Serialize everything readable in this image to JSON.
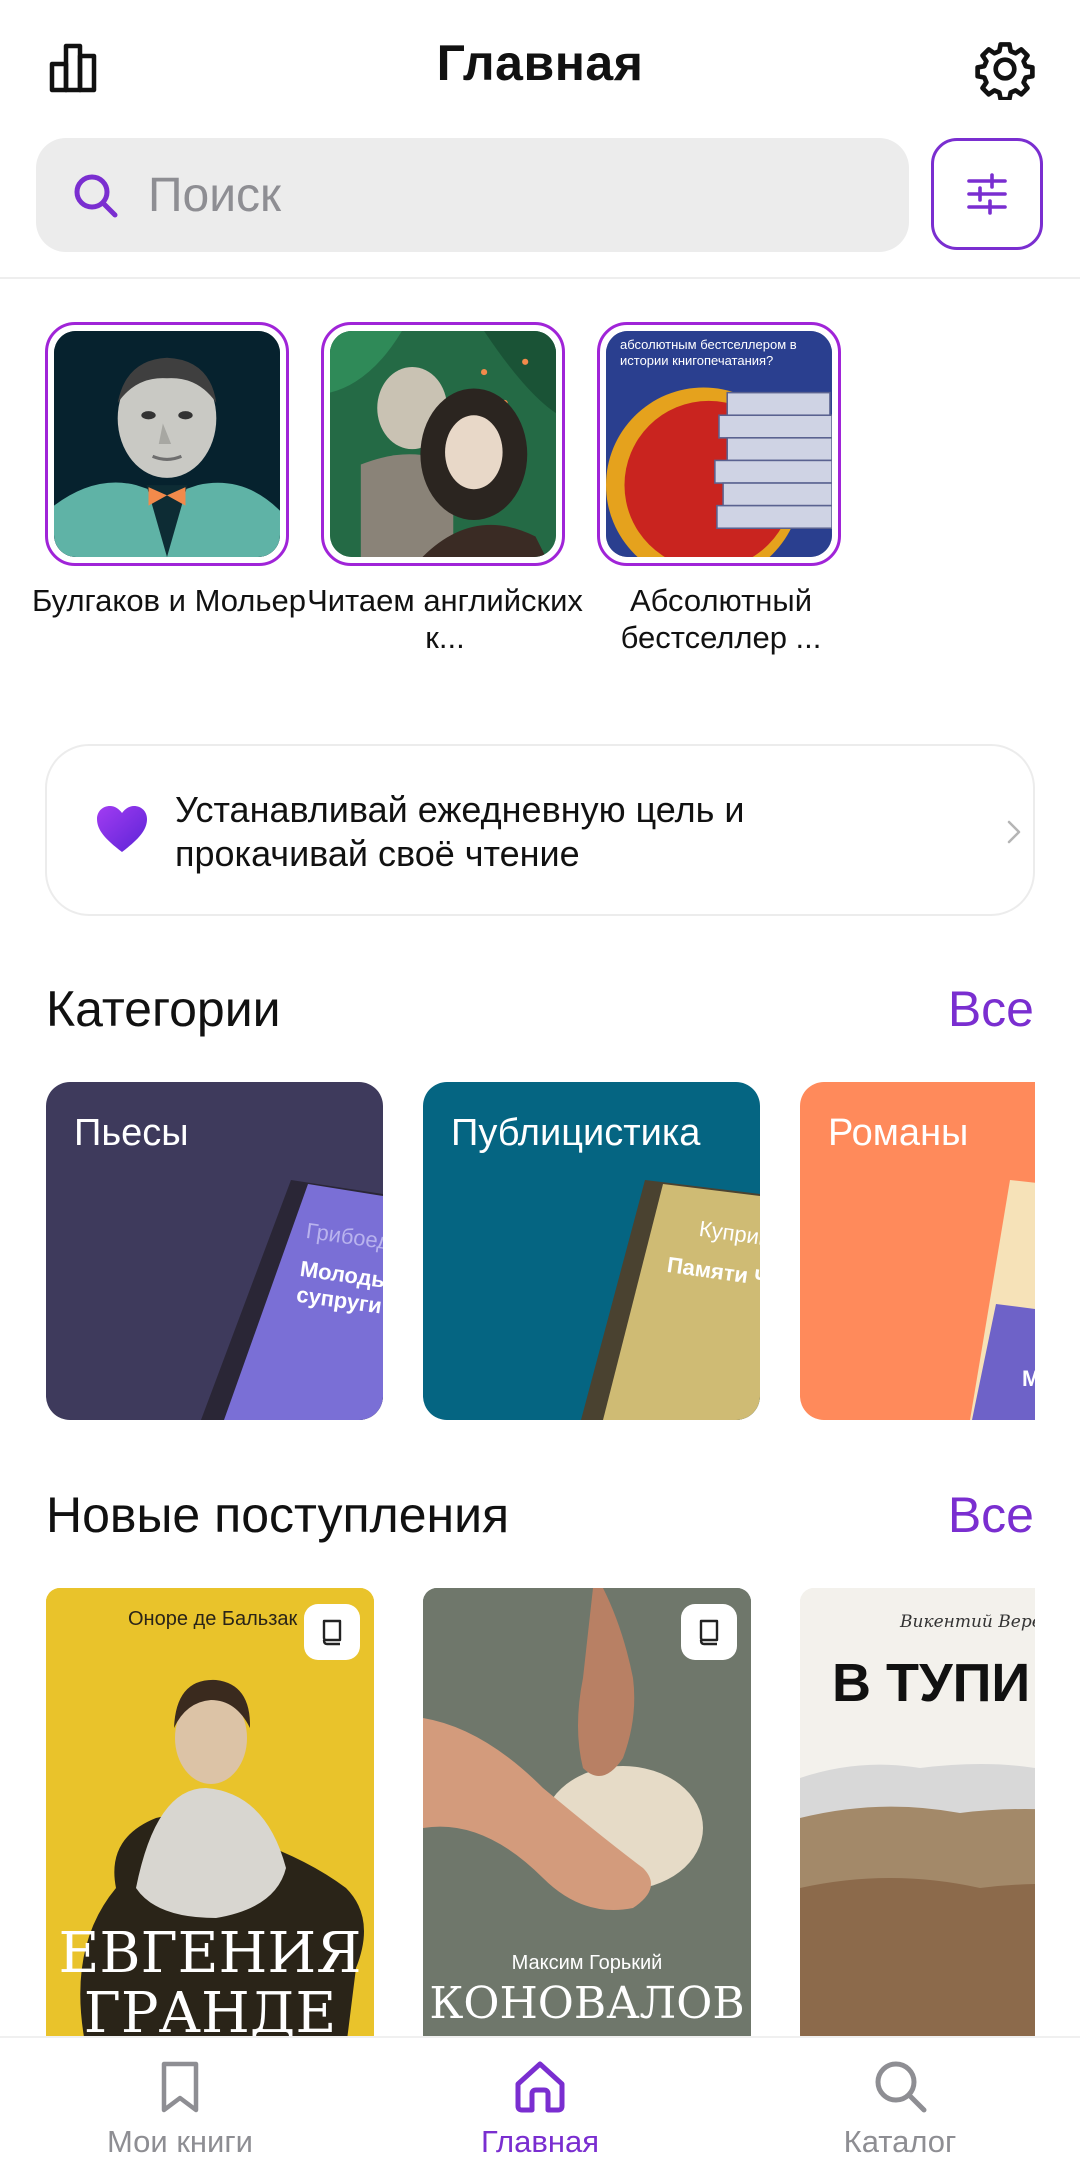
{
  "header": {
    "title": "Главная"
  },
  "search": {
    "placeholder": "Поиск"
  },
  "stories": [
    {
      "label": "Булгаков и Мольер"
    },
    {
      "label": "Читаем английских к..."
    },
    {
      "label": "Абсолютный бестселлер ...",
      "cover_caption": "абсолютным бестселлером в истории книгопечатания?"
    }
  ],
  "goal_banner": {
    "text": "Устанавливай ежедневную цель и прокачивай своё чтение"
  },
  "categories_section": {
    "title": "Категории",
    "all_label": "Все",
    "items": [
      {
        "label": "Пьесы",
        "color": "#3e3a5c",
        "book_author": "Грибоедов",
        "book_title": "Молодые супруги"
      },
      {
        "label": "Публицистика",
        "color": "#056582",
        "book_author": "Куприн",
        "book_title": "Памяти Ч"
      },
      {
        "label": "Романы",
        "color": "#ff8a5b",
        "book_author": "",
        "book_title": "М"
      }
    ]
  },
  "new_arrivals_section": {
    "title": "Новые поступления",
    "all_label": "Все",
    "books": [
      {
        "author": "Оноре де Бальзак",
        "title": "ЕВГЕНИЯ ГРАНДЕ",
        "badge": "book-icon"
      },
      {
        "author": "Максим Горький",
        "title": "КОНОВАЛОВ",
        "badge": "book-icon"
      },
      {
        "author": "Викентий Вересаев",
        "title": "В ТУПИ"
      }
    ]
  },
  "bottom_nav": {
    "items": [
      {
        "label": "Мои книги",
        "icon": "bookmark-icon",
        "active": false
      },
      {
        "label": "Главная",
        "icon": "home-icon",
        "active": true
      },
      {
        "label": "Каталог",
        "icon": "search-icon",
        "active": false
      }
    ]
  },
  "colors": {
    "accent": "#7a2ed0",
    "story_ring": "#a024d8",
    "inactive": "#8e8e93"
  }
}
